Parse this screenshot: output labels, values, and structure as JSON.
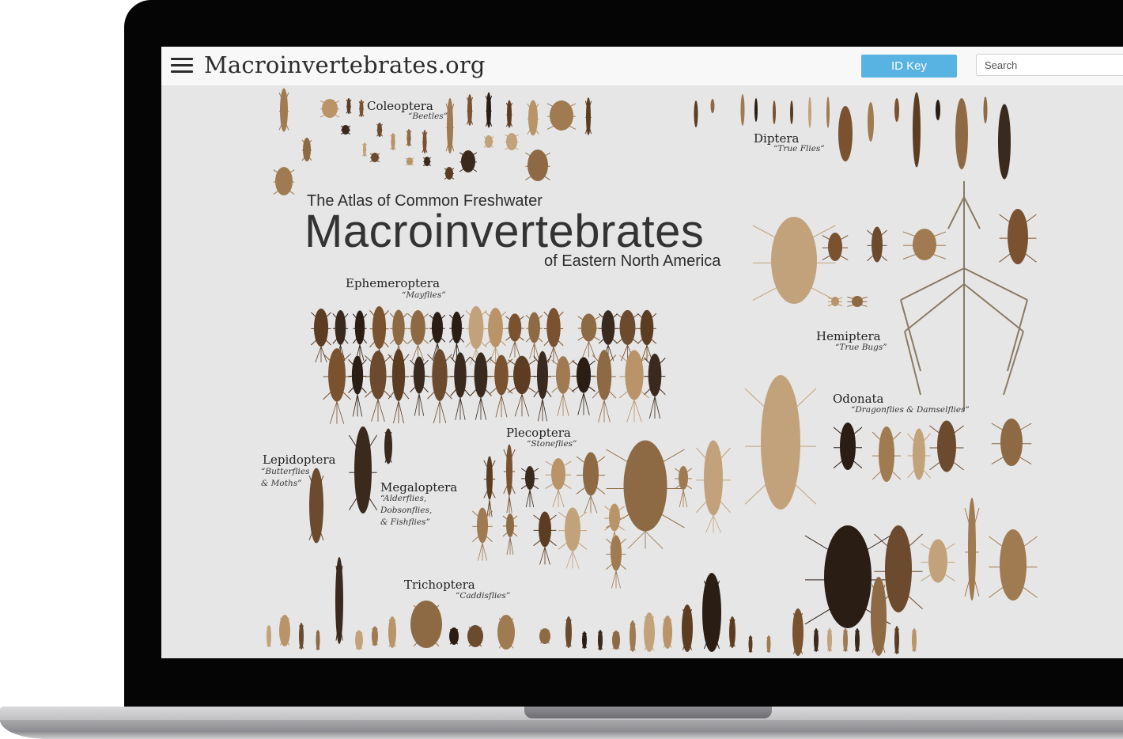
{
  "site": {
    "title": "Macroinvertebrates.org"
  },
  "nav": {
    "id_key_label": "ID Key",
    "search_placeholder": "Search"
  },
  "poster": {
    "atlas_line": "The Atlas of Common Freshwater",
    "atlas_title": "Macroinvertebrates",
    "atlas_subtitle": "of Eastern North America"
  },
  "orders": {
    "coleoptera": {
      "name": "Coleoptera",
      "common": "“Beetles”"
    },
    "diptera": {
      "name": "Diptera",
      "common": "“True Flies”"
    },
    "ephemeroptera": {
      "name": "Ephemeroptera",
      "common": "“Mayflies”"
    },
    "hemiptera": {
      "name": "Hemiptera",
      "common": "“True Bugs”"
    },
    "odonata": {
      "name": "Odonata",
      "common": "“Dragonflies & Damselflies”"
    },
    "plecoptera": {
      "name": "Plecoptera",
      "common": "“Stoneflies”"
    },
    "lepidoptera": {
      "name": "Lepidoptera",
      "common": "“Butterflies\n& Moths”"
    },
    "megaloptera": {
      "name": "Megaloptera",
      "common": "“Alderflies,\nDobsonflies,\n& Fishflies”"
    },
    "trichoptera": {
      "name": "Trichoptera",
      "common": "“Caddisflies”"
    }
  },
  "colors": {
    "accent": "#58b3e3",
    "poster_bg": "#e6e6e6",
    "bezel": "#050505"
  },
  "icons": {
    "menu": "hamburger-menu-icon"
  }
}
